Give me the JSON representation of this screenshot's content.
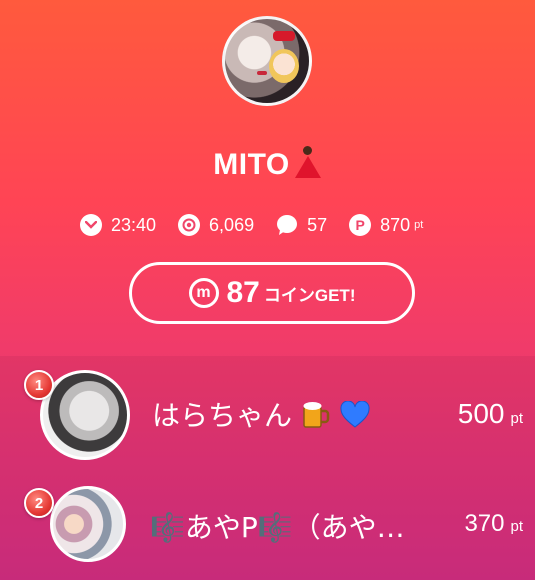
{
  "profile": {
    "name": "MITO",
    "name_emoji": "dancer"
  },
  "stats": [
    {
      "icon": "chevron-down-icon",
      "value": "23:40"
    },
    {
      "icon": "eye-icon",
      "value": "6,069"
    },
    {
      "icon": "chat-bubble-icon",
      "value": "57"
    },
    {
      "icon": "points-p-icon",
      "value": "870",
      "unit": "pt"
    }
  ],
  "coin_button": {
    "badge": "m",
    "amount": "87",
    "label": "コインGET!"
  },
  "ranking": [
    {
      "rank": "1",
      "name": "はらちゃん",
      "emojis": [
        "beer-mug",
        "blue-heart"
      ],
      "points": "500",
      "unit": "pt"
    },
    {
      "rank": "2",
      "name": "🎼あやP🎼（あや…",
      "points": "370",
      "unit": "pt"
    }
  ]
}
